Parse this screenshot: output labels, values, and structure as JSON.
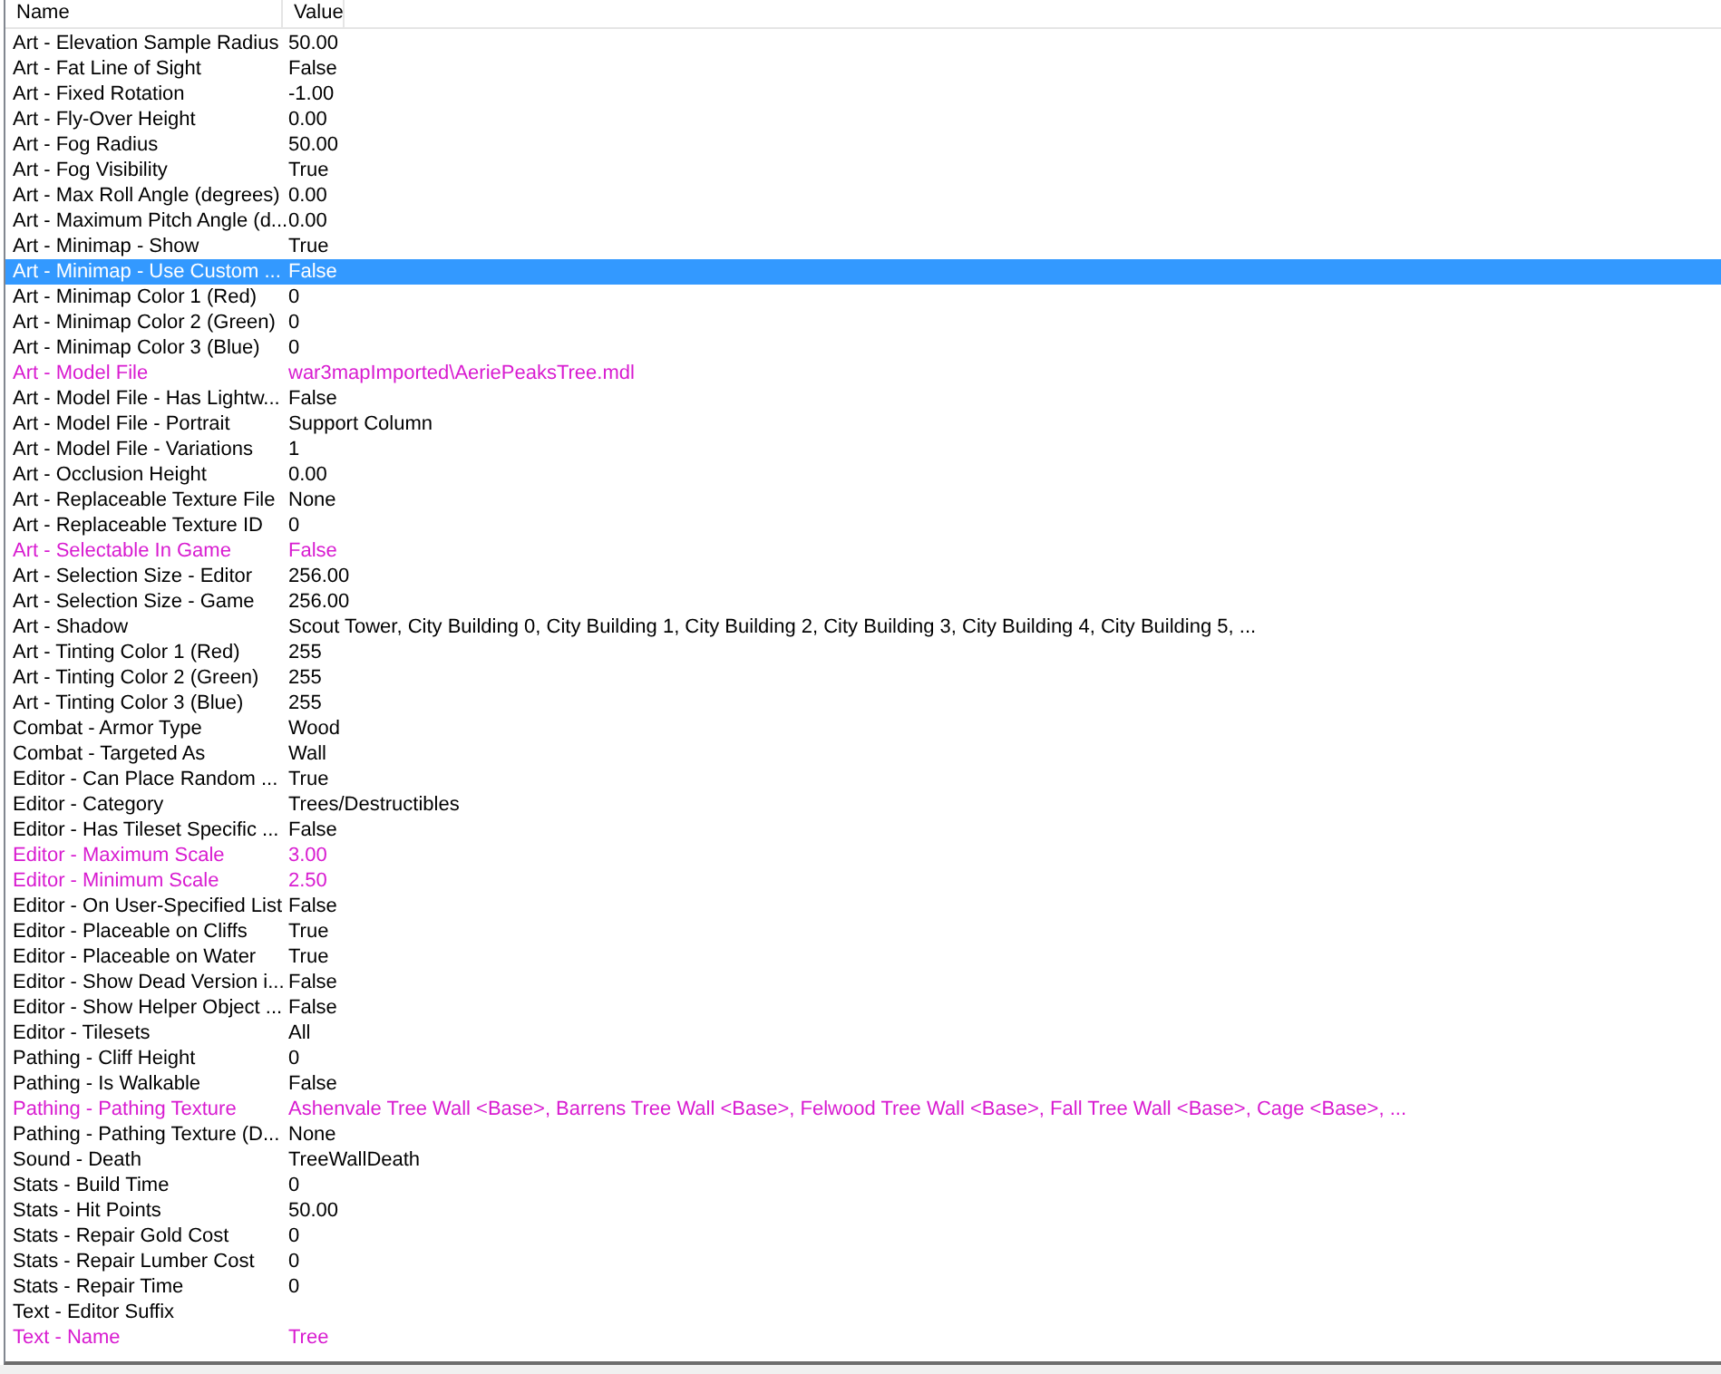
{
  "columns": [
    "Name",
    "Value"
  ],
  "rows": [
    {
      "name": "Art - Elevation Sample Radius",
      "value": "50.00",
      "modified": false,
      "selected": false
    },
    {
      "name": "Art - Fat Line of Sight",
      "value": "False",
      "modified": false,
      "selected": false
    },
    {
      "name": "Art - Fixed Rotation",
      "value": "-1.00",
      "modified": false,
      "selected": false
    },
    {
      "name": "Art - Fly-Over Height",
      "value": "0.00",
      "modified": false,
      "selected": false
    },
    {
      "name": "Art - Fog Radius",
      "value": "50.00",
      "modified": false,
      "selected": false
    },
    {
      "name": "Art - Fog Visibility",
      "value": "True",
      "modified": false,
      "selected": false
    },
    {
      "name": "Art - Max Roll Angle (degrees)",
      "value": "0.00",
      "modified": false,
      "selected": false
    },
    {
      "name": "Art - Maximum Pitch Angle (d...",
      "value": "0.00",
      "modified": false,
      "selected": false
    },
    {
      "name": "Art - Minimap - Show",
      "value": "True",
      "modified": false,
      "selected": false
    },
    {
      "name": "Art - Minimap - Use Custom ...",
      "value": "False",
      "modified": false,
      "selected": true
    },
    {
      "name": "Art - Minimap Color 1 (Red)",
      "value": "0",
      "modified": false,
      "selected": false
    },
    {
      "name": "Art - Minimap Color 2 (Green)",
      "value": "0",
      "modified": false,
      "selected": false
    },
    {
      "name": "Art - Minimap Color 3 (Blue)",
      "value": "0",
      "modified": false,
      "selected": false
    },
    {
      "name": "Art - Model File",
      "value": "war3mapImported\\AeriePeaksTree.mdl",
      "modified": true,
      "selected": false
    },
    {
      "name": "Art - Model File - Has Lightw...",
      "value": "False",
      "modified": false,
      "selected": false
    },
    {
      "name": "Art - Model File - Portrait",
      "value": "Support Column",
      "modified": false,
      "selected": false
    },
    {
      "name": "Art - Model File - Variations",
      "value": "1",
      "modified": false,
      "selected": false
    },
    {
      "name": "Art - Occlusion Height",
      "value": "0.00",
      "modified": false,
      "selected": false
    },
    {
      "name": "Art - Replaceable Texture File",
      "value": "None",
      "modified": false,
      "selected": false
    },
    {
      "name": "Art - Replaceable Texture ID",
      "value": "0",
      "modified": false,
      "selected": false
    },
    {
      "name": "Art - Selectable In Game",
      "value": "False",
      "modified": true,
      "selected": false
    },
    {
      "name": "Art - Selection Size - Editor",
      "value": "256.00",
      "modified": false,
      "selected": false
    },
    {
      "name": "Art - Selection Size - Game",
      "value": "256.00",
      "modified": false,
      "selected": false
    },
    {
      "name": "Art - Shadow",
      "value": "Scout Tower, City Building 0, City Building 1, City Building 2, City Building 3, City Building 4, City Building 5, ...",
      "modified": false,
      "selected": false
    },
    {
      "name": "Art - Tinting Color 1 (Red)",
      "value": "255",
      "modified": false,
      "selected": false
    },
    {
      "name": "Art - Tinting Color 2 (Green)",
      "value": "255",
      "modified": false,
      "selected": false
    },
    {
      "name": "Art - Tinting Color 3 (Blue)",
      "value": "255",
      "modified": false,
      "selected": false
    },
    {
      "name": "Combat - Armor Type",
      "value": "Wood",
      "modified": false,
      "selected": false
    },
    {
      "name": "Combat - Targeted As",
      "value": "Wall",
      "modified": false,
      "selected": false
    },
    {
      "name": "Editor - Can Place Random ...",
      "value": "True",
      "modified": false,
      "selected": false
    },
    {
      "name": "Editor - Category",
      "value": "Trees/Destructibles",
      "modified": false,
      "selected": false
    },
    {
      "name": "Editor - Has Tileset Specific ...",
      "value": "False",
      "modified": false,
      "selected": false
    },
    {
      "name": "Editor - Maximum Scale",
      "value": "3.00",
      "modified": true,
      "selected": false
    },
    {
      "name": "Editor - Minimum Scale",
      "value": "2.50",
      "modified": true,
      "selected": false
    },
    {
      "name": "Editor - On User-Specified List",
      "value": "False",
      "modified": false,
      "selected": false
    },
    {
      "name": "Editor - Placeable on Cliffs",
      "value": "True",
      "modified": false,
      "selected": false
    },
    {
      "name": "Editor - Placeable on Water",
      "value": "True",
      "modified": false,
      "selected": false
    },
    {
      "name": "Editor - Show Dead Version i...",
      "value": "False",
      "modified": false,
      "selected": false
    },
    {
      "name": "Editor - Show Helper Object ...",
      "value": "False",
      "modified": false,
      "selected": false
    },
    {
      "name": "Editor - Tilesets",
      "value": "All",
      "modified": false,
      "selected": false
    },
    {
      "name": "Pathing - Cliff Height",
      "value": "0",
      "modified": false,
      "selected": false
    },
    {
      "name": "Pathing - Is Walkable",
      "value": "False",
      "modified": false,
      "selected": false
    },
    {
      "name": "Pathing - Pathing Texture",
      "value": "Ashenvale Tree Wall <Base>, Barrens Tree Wall <Base>, Felwood Tree Wall <Base>, Fall Tree Wall <Base>, Cage <Base>, ...",
      "modified": true,
      "selected": false
    },
    {
      "name": "Pathing - Pathing Texture (D...",
      "value": "None",
      "modified": false,
      "selected": false
    },
    {
      "name": "Sound - Death",
      "value": "TreeWallDeath",
      "modified": false,
      "selected": false
    },
    {
      "name": "Stats - Build Time",
      "value": "0",
      "modified": false,
      "selected": false
    },
    {
      "name": "Stats - Hit Points",
      "value": "50.00",
      "modified": false,
      "selected": false
    },
    {
      "name": "Stats - Repair Gold Cost",
      "value": "0",
      "modified": false,
      "selected": false
    },
    {
      "name": "Stats - Repair Lumber Cost",
      "value": "0",
      "modified": false,
      "selected": false
    },
    {
      "name": "Stats - Repair Time",
      "value": "0",
      "modified": false,
      "selected": false
    },
    {
      "name": "Text - Editor Suffix",
      "value": "",
      "modified": false,
      "selected": false
    },
    {
      "name": "Text - Name",
      "value": "Tree",
      "modified": true,
      "selected": false
    }
  ]
}
